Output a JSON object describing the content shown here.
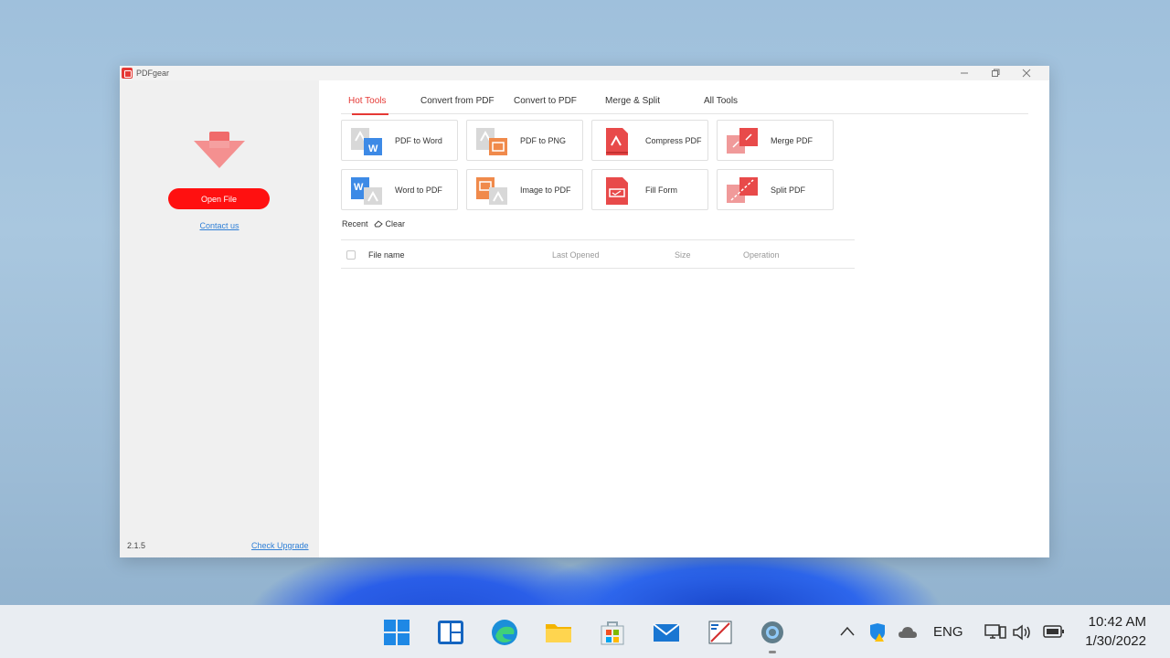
{
  "window": {
    "title": "PDFgear",
    "controls": [
      "minimize-icon",
      "restore-icon",
      "close-icon"
    ]
  },
  "sidebar": {
    "open_file": "Open File",
    "contact_us": "Contact us",
    "version": "2.1.5",
    "check_upgrade": "Check Upgrade"
  },
  "tabs": [
    {
      "label": "Hot Tools",
      "active": true
    },
    {
      "label": "Convert from PDF",
      "active": false
    },
    {
      "label": "Convert to PDF",
      "active": false
    },
    {
      "label": "Merge & Split",
      "active": false
    },
    {
      "label": "All Tools",
      "active": false
    }
  ],
  "tools": [
    {
      "label": "PDF to Word",
      "icon": "pdf-to-word-icon"
    },
    {
      "label": "PDF to PNG",
      "icon": "pdf-to-png-icon"
    },
    {
      "label": "Compress PDF",
      "icon": "compress-pdf-icon"
    },
    {
      "label": "Merge PDF",
      "icon": "merge-pdf-icon"
    },
    {
      "label": "Word to PDF",
      "icon": "word-to-pdf-icon"
    },
    {
      "label": "Image to PDF",
      "icon": "image-to-pdf-icon"
    },
    {
      "label": "Fill Form",
      "icon": "fill-form-icon"
    },
    {
      "label": "Split PDF",
      "icon": "split-pdf-icon"
    }
  ],
  "recent": {
    "label": "Recent",
    "clear": "Clear",
    "columns": [
      "File name",
      "Last Opened",
      "Size",
      "Operation"
    ]
  },
  "taskbar": {
    "apps": [
      "start-icon",
      "widgets-icon",
      "edge-icon",
      "file-explorer-icon",
      "store-icon",
      "mail-icon",
      "snipping-tool-icon",
      "settings-icon"
    ],
    "language": "ENG",
    "time": "10:42 AM",
    "date": "1/30/2022"
  },
  "colors": {
    "accent": "#ff1010",
    "link": "#2f7fd6",
    "active_tab": "#e53935"
  }
}
